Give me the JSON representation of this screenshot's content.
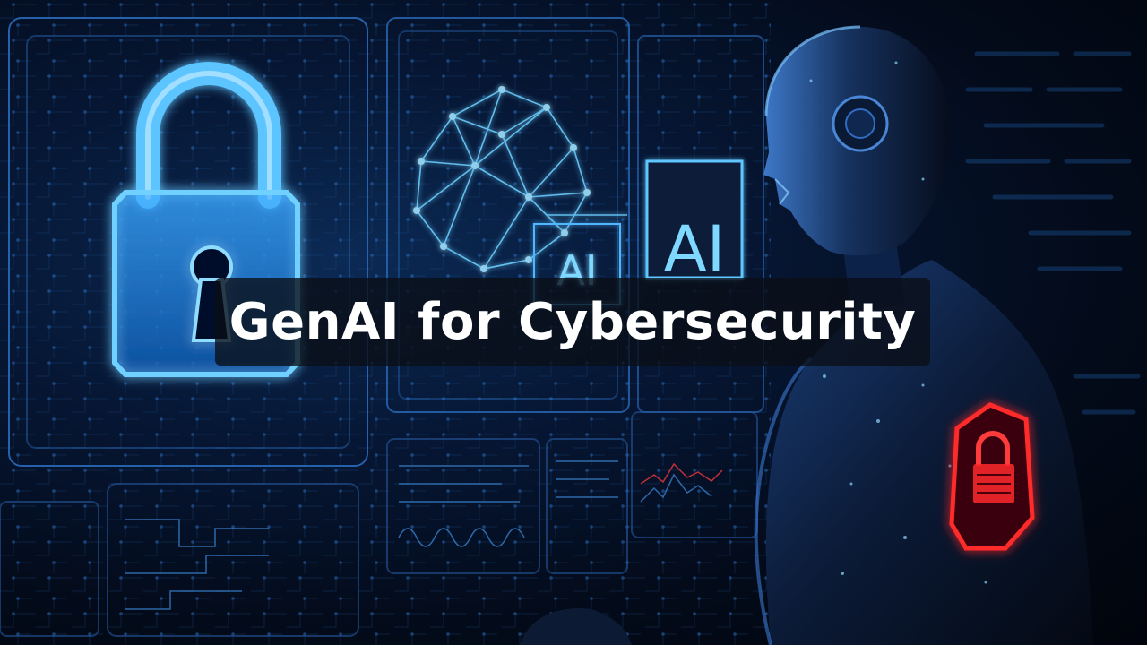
{
  "title": "GenAI for Cybersecurity",
  "panels": {
    "ai_label_main": "AI",
    "ai_label_small": "AI"
  },
  "colors": {
    "accent_blue": "#3fb8ff",
    "glow_cyan": "#7fd8ff",
    "alert_red": "#ff2a2a",
    "title_text": "#ffffff"
  },
  "icons": {
    "main_lock": "padlock-icon",
    "shoulder_lock": "padlock-icon",
    "network": "neural-network-icon"
  }
}
